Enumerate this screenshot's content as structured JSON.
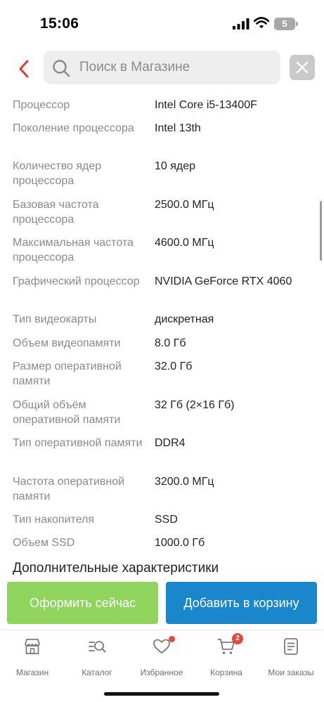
{
  "status_bar": {
    "time": "15:06",
    "battery_level": "5",
    "icons": [
      "signal-icon",
      "wifi-icon",
      "battery-icon"
    ]
  },
  "header": {
    "back_icon": "chevron-left-icon",
    "search_placeholder": "Поиск в Магазине",
    "clear_icon": "close-icon"
  },
  "specs": {
    "rows": [
      {
        "label": "Процессор",
        "value": "Intel Core i5-13400F"
      },
      {
        "label": "Поколение процессора",
        "value": "Intel 13th"
      },
      {
        "label": "Количество ядер процессора",
        "value": "10 ядер"
      },
      {
        "label": "Базовая частота процессора",
        "value": "2500.0 МГц"
      },
      {
        "label": "Максимальная частота процессора",
        "value": "4600.0 МГц"
      },
      {
        "label": "Графический процессор",
        "value": "NVIDIA GeForce RTX 4060"
      },
      {
        "label": "Тип видеокарты",
        "value": "дискретная"
      },
      {
        "label": "Объем видеопамяти",
        "value": "8.0 Гб"
      },
      {
        "label": "Размер оперативной памяти",
        "value": "32.0 Гб"
      },
      {
        "label": "Общий объём оперативной памяти",
        "value": "32 Гб (2×16 Гб)"
      },
      {
        "label": "Тип оперативной памяти",
        "value": "DDR4"
      },
      {
        "label": "Частота оперативной памяти",
        "value": "3200.0 МГц"
      },
      {
        "label": "Тип накопителя",
        "value": "SSD"
      },
      {
        "label": "Объем SSD",
        "value": "1000.0 Гб"
      }
    ],
    "next_section_title": "Дополнительные характеристики"
  },
  "actions": {
    "buy_now_label": "Оформить сейчас",
    "add_to_cart_label": "Добавить в корзину",
    "buy_color": "#8fd45c",
    "cart_color": "#1a86cc"
  },
  "bottom_nav": {
    "items": [
      {
        "label": "Магазин",
        "icon": "store-icon"
      },
      {
        "label": "Каталог",
        "icon": "catalog-search-icon"
      },
      {
        "label": "Избранное",
        "icon": "heart-icon"
      },
      {
        "label": "Корзина",
        "icon": "cart-icon"
      },
      {
        "label": "Мои заказы",
        "icon": "orders-icon"
      }
    ],
    "cart_badge": "2",
    "accent_color": "#e8453c"
  }
}
